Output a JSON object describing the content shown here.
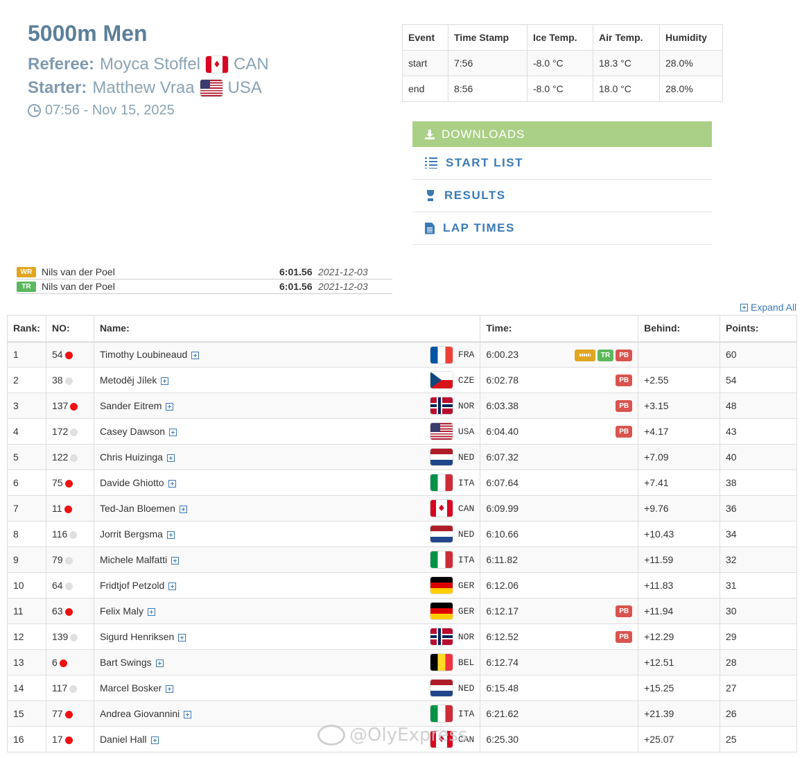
{
  "event": {
    "title": "5000m Men",
    "referee_label": "Referee:",
    "referee_name": "Moyca Stoffel",
    "referee_nat": "CAN",
    "starter_label": "Starter:",
    "starter_name": "Matthew Vraa",
    "starter_nat": "USA",
    "datetime": "07:56 - Nov 15, 2025"
  },
  "conditions": {
    "headers": [
      "Event",
      "Time Stamp",
      "Ice Temp.",
      "Air Temp.",
      "Humidity"
    ],
    "rows": [
      [
        "start",
        "7:56",
        "-8.0 °C",
        "18.3 °C",
        "28.0%"
      ],
      [
        "end",
        "8:56",
        "-8.0 °C",
        "18.0 °C",
        "28.0%"
      ]
    ]
  },
  "downloads": {
    "header": "DOWNLOADS",
    "items": [
      "START LIST",
      "RESULTS",
      "LAP TIMES"
    ]
  },
  "records": [
    {
      "badge": "WR",
      "name": "Nils van der Poel",
      "time": "6:01.56",
      "date": "2021-12-03"
    },
    {
      "badge": "TR",
      "name": "Nils van der Poel",
      "time": "6:01.56",
      "date": "2021-12-03"
    }
  ],
  "expand_all": "Expand All",
  "results": {
    "headers": [
      "Rank:",
      "NO:",
      "Name:",
      "Time:",
      "Behind:",
      "Points:"
    ],
    "rows": [
      {
        "rank": "1",
        "no": "54",
        "dot": "red",
        "name": "Timothy Loubineaud",
        "nat": "FRA",
        "time": "6:00.23",
        "badges": [
          "WR",
          "TR",
          "PB"
        ],
        "behind": "",
        "points": "60"
      },
      {
        "rank": "2",
        "no": "38",
        "dot": "grey",
        "name": "Metoděj Jílek",
        "nat": "CZE",
        "time": "6:02.78",
        "badges": [
          "PB"
        ],
        "behind": "+2.55",
        "points": "54"
      },
      {
        "rank": "3",
        "no": "137",
        "dot": "red",
        "name": "Sander Eitrem",
        "nat": "NOR",
        "time": "6:03.38",
        "badges": [
          "PB"
        ],
        "behind": "+3.15",
        "points": "48"
      },
      {
        "rank": "4",
        "no": "172",
        "dot": "grey",
        "name": "Casey Dawson",
        "nat": "USA",
        "time": "6:04.40",
        "badges": [
          "PB"
        ],
        "behind": "+4.17",
        "points": "43"
      },
      {
        "rank": "5",
        "no": "122",
        "dot": "grey",
        "name": "Chris Huizinga",
        "nat": "NED",
        "time": "6:07.32",
        "badges": [],
        "behind": "+7.09",
        "points": "40"
      },
      {
        "rank": "6",
        "no": "75",
        "dot": "red",
        "name": "Davide Ghiotto",
        "nat": "ITA",
        "time": "6:07.64",
        "badges": [],
        "behind": "+7.41",
        "points": "38"
      },
      {
        "rank": "7",
        "no": "11",
        "dot": "red",
        "name": "Ted-Jan Bloemen",
        "nat": "CAN",
        "time": "6:09.99",
        "badges": [],
        "behind": "+9.76",
        "points": "36"
      },
      {
        "rank": "8",
        "no": "116",
        "dot": "grey",
        "name": "Jorrit Bergsma",
        "nat": "NED",
        "time": "6:10.66",
        "badges": [],
        "behind": "+10.43",
        "points": "34"
      },
      {
        "rank": "9",
        "no": "79",
        "dot": "grey",
        "name": "Michele Malfatti",
        "nat": "ITA",
        "time": "6:11.82",
        "badges": [],
        "behind": "+11.59",
        "points": "32"
      },
      {
        "rank": "10",
        "no": "64",
        "dot": "grey",
        "name": "Fridtjof Petzold",
        "nat": "GER",
        "time": "6:12.06",
        "badges": [],
        "behind": "+11.83",
        "points": "31"
      },
      {
        "rank": "11",
        "no": "63",
        "dot": "red",
        "name": "Felix Maly",
        "nat": "GER",
        "time": "6:12.17",
        "badges": [
          "PB"
        ],
        "behind": "+11.94",
        "points": "30"
      },
      {
        "rank": "12",
        "no": "139",
        "dot": "grey",
        "name": "Sigurd Henriksen",
        "nat": "NOR",
        "time": "6:12.52",
        "badges": [
          "PB"
        ],
        "behind": "+12.29",
        "points": "29"
      },
      {
        "rank": "13",
        "no": "6",
        "dot": "red",
        "name": "Bart Swings",
        "nat": "BEL",
        "time": "6:12.74",
        "badges": [],
        "behind": "+12.51",
        "points": "28"
      },
      {
        "rank": "14",
        "no": "117",
        "dot": "grey",
        "name": "Marcel Bosker",
        "nat": "NED",
        "time": "6:15.48",
        "badges": [],
        "behind": "+15.25",
        "points": "27"
      },
      {
        "rank": "15",
        "no": "77",
        "dot": "red",
        "name": "Andrea Giovannini",
        "nat": "ITA",
        "time": "6:21.62",
        "badges": [],
        "behind": "+21.39",
        "points": "26"
      },
      {
        "rank": "16",
        "no": "17",
        "dot": "red",
        "name": "Daniel Hall",
        "nat": "CAN",
        "time": "6:25.30",
        "badges": [],
        "behind": "+25.07",
        "points": "25"
      }
    ]
  },
  "watermark": "@OlyExpress"
}
